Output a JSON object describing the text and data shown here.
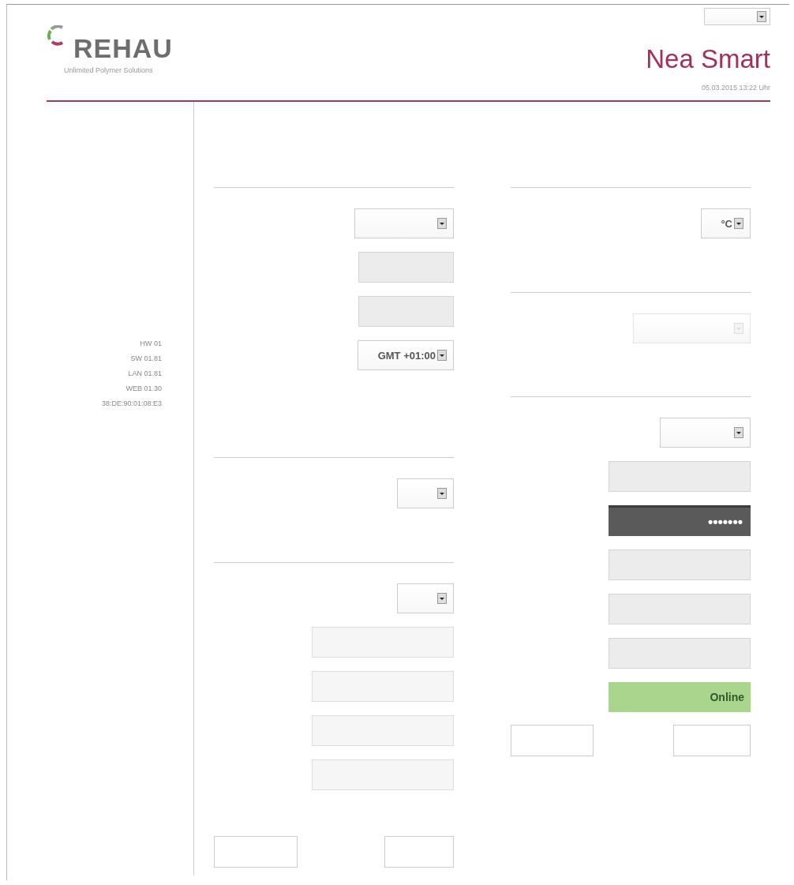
{
  "header": {
    "brand": "REHAU",
    "tagline": "Unlimited Polymer Solutions",
    "language_select": {
      "kind": "select"
    },
    "title": "Nea Smart",
    "datetime": "05.03.2015 13:22 Uhr"
  },
  "sidebar": {
    "info": [
      "HW 01",
      "SW 01.81",
      "LAN 01.81",
      "WEB 01.30",
      "38:DE:90:01:08:E3"
    ]
  },
  "left_column": {
    "sections": [
      {
        "fields": [
          {
            "kind": "select",
            "disabled": false
          },
          {
            "kind": "readonly-input"
          },
          {
            "kind": "readonly-input"
          },
          {
            "kind": "select",
            "value": "GMT +01:00",
            "disabled": false
          }
        ]
      },
      {
        "fields": [
          {
            "kind": "select",
            "disabled": false
          }
        ]
      },
      {
        "fields": [
          {
            "kind": "select",
            "disabled": false
          },
          {
            "kind": "input"
          },
          {
            "kind": "input"
          },
          {
            "kind": "input"
          },
          {
            "kind": "input"
          }
        ]
      }
    ],
    "buttons": [
      {
        "kind": "button"
      },
      {
        "kind": "button"
      }
    ]
  },
  "right_column": {
    "sections": [
      {
        "fields": [
          {
            "kind": "select",
            "value": "°C",
            "disabled": false
          }
        ]
      },
      {
        "fields": [
          {
            "kind": "select",
            "disabled": true
          }
        ]
      },
      {
        "fields": [
          {
            "kind": "select",
            "disabled": false
          },
          {
            "kind": "readonly-input"
          },
          {
            "kind": "password",
            "value": "•••••••"
          },
          {
            "kind": "readonly-input"
          },
          {
            "kind": "readonly-input"
          },
          {
            "kind": "readonly-input"
          },
          {
            "kind": "status",
            "value": "Online",
            "connected": true
          }
        ]
      }
    ],
    "buttons": [
      {
        "kind": "button"
      },
      {
        "kind": "button"
      }
    ]
  }
}
